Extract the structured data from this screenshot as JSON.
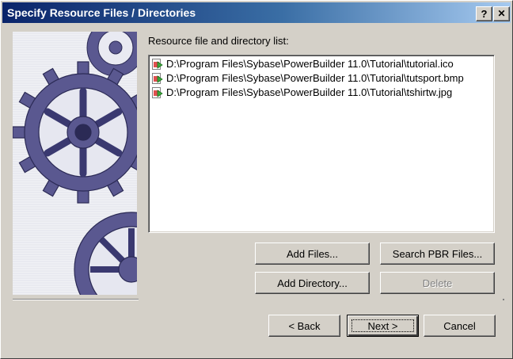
{
  "window": {
    "title": "Specify Resource Files / Directories",
    "help_button": "?",
    "close_button": "✕"
  },
  "resource_list": {
    "label": "Resource file and directory list:",
    "items": [
      {
        "path": "D:\\Program Files\\Sybase\\PowerBuilder 11.0\\Tutorial\\tutorial.ico",
        "icon": "resource-file-icon"
      },
      {
        "path": "D:\\Program Files\\Sybase\\PowerBuilder 11.0\\Tutorial\\tutsport.bmp",
        "icon": "resource-file-icon"
      },
      {
        "path": "D:\\Program Files\\Sybase\\PowerBuilder 11.0\\Tutorial\\tshirtw.jpg",
        "icon": "resource-file-icon"
      }
    ]
  },
  "buttons": {
    "add_files": "Add Files...",
    "search_pbr": "Search PBR Files...",
    "add_directory": "Add Directory...",
    "delete": "Delete",
    "back": "< Back",
    "next": "Next >",
    "cancel": "Cancel"
  },
  "colors": {
    "title_bar_start": "#0a246a",
    "title_bar_end": "#a6caf0",
    "face": "#d4d0c8",
    "gear": "#5a5890"
  }
}
